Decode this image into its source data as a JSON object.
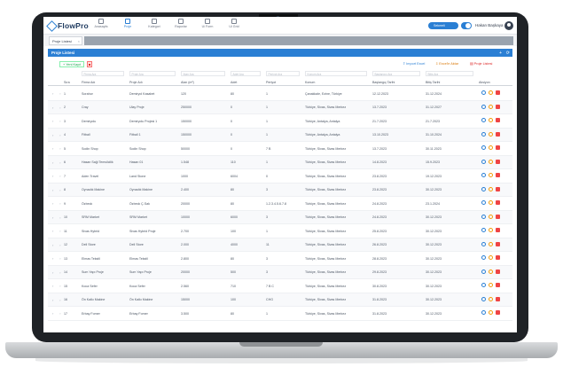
{
  "app": {
    "logo": "FlowPro"
  },
  "nav": [
    {
      "label": "Anasayfa",
      "active": false
    },
    {
      "label": "Proje",
      "active": true
    },
    {
      "label": "Kategori",
      "active": false
    },
    {
      "label": "Raporlar",
      "active": false
    },
    {
      "label": "Ui Form",
      "active": false
    },
    {
      "label": "Ui Grid",
      "active": false
    }
  ],
  "header": {
    "toggle_label": "Sekmeli",
    "user_name": "Hakan Başkaya"
  },
  "tabs": [
    {
      "label": "Proje Listesi"
    }
  ],
  "panel": {
    "title": "Proje Listesi"
  },
  "toolbar": {
    "add_label": "Yeni Kayıt",
    "import_label": "Import Excel",
    "export_label": "Excel'e Aktar",
    "list_label": "Proje Listesi"
  },
  "filters": [
    "Firma Ara",
    "Proje Ara",
    "Alan Ara",
    "Adet Ara",
    "Periyot Ara",
    "Konum Ara",
    "Başlangıç Ara",
    "Bitiş Ara"
  ],
  "table": {
    "columns": [
      "Sıra",
      "Firma Adı",
      "Proje Adı",
      "Alan (m²)",
      "Adet",
      "Periyot",
      "Konum",
      "Başlangıç Tarihi",
      "Bitiş Tarihi",
      "Aksiyon"
    ],
    "rows": [
      [
        "1",
        "Sorahor",
        "Demiryol Kasabet",
        "120",
        "80",
        "1",
        "Çanakkale, Ezine, Türkiye",
        "12.12.2023",
        "31.12.2024"
      ],
      [
        "2",
        "Cray",
        "Ulay Proje",
        "250000",
        "0",
        "1",
        "Türkiye, Sivas, Sivas Merkez",
        "13.7.2023",
        "31.12.2027"
      ],
      [
        "3",
        "Demiryolu",
        "Demiryolu Projesi 1",
        "150000",
        "0",
        "1",
        "Türkiye, Antalya, Antalya",
        "21.7.2023",
        "21.7.2023"
      ],
      [
        "4",
        "Fitball",
        "Fitball 1",
        "150000",
        "0",
        "1",
        "Türkiye, Antalya, Antalya",
        "13.10.2023",
        "31.10.2024"
      ],
      [
        "5",
        "Sodin Shop",
        "Sodin Shop",
        "50000",
        "0",
        "7 B",
        "Türkiye, Sivas, Sivas Merkez",
        "13.7.2023",
        "30.11.2023"
      ],
      [
        "6",
        "Hasan Saği Temsilcilik",
        "Hasan 01",
        "1.548",
        "110",
        "1",
        "Türkiye, Sivas, Sivas Merkez",
        "14.8.2023",
        "15.9.2023"
      ],
      [
        "7",
        "Aden Travel",
        "Land Stone",
        "1000",
        "6004",
        "0",
        "Türkiye, Sivas, Sivas Merkez",
        "23.8.2023",
        "19.12.2023"
      ],
      [
        "8",
        "Oynadık Makine",
        "Oynadık Makine",
        "2.400",
        "80",
        "3",
        "Türkiye, Sivas, Sivas Merkez",
        "23.8.2023",
        "30.12.2023"
      ],
      [
        "9",
        "Özbeck",
        "Özbeck Ç.Sak",
        "20000",
        "80",
        "1.2.3.4.5.6.7.8",
        "Türkiye, Sivas, Sivas Merkez",
        "24.8.2023",
        "23.1.2024"
      ],
      [
        "10",
        "SRM Market",
        "SRM Market",
        "10000",
        "6000",
        "3",
        "Türkiye, Sivas, Sivas Merkez",
        "24.8.2023",
        "30.12.2023"
      ],
      [
        "11",
        "Sivas Hybrid",
        "Sivas Hybrid Proje",
        "2.700",
        "100",
        "1",
        "Türkiye, Sivas, Sivas Merkez",
        "25.8.2023",
        "30.12.2023"
      ],
      [
        "12",
        "Dell Store",
        "Dell Store",
        "2.000",
        "4000",
        "11",
        "Türkiye, Sivas, Sivas Merkez",
        "26.8.2023",
        "30.12.2023"
      ],
      [
        "13",
        "Elmas Tekstil",
        "Elmas Tekstil",
        "2.800",
        "80",
        "3",
        "Türkiye, Sivas, Sivas Merkez",
        "28.8.2023",
        "30.12.2023"
      ],
      [
        "14",
        "Sum Yapı Proje",
        "Sum Yapı Proje",
        "20000",
        "500",
        "3",
        "Türkiye, Sivas, Sivas Merkez",
        "29.8.2023",
        "30.12.2023"
      ],
      [
        "15",
        "Koca Sefer",
        "Koca Sefer",
        "2.560",
        "710",
        "7 B C",
        "Türkiye, Sivas, Sivas Merkez",
        "30.8.2023",
        "30.12.2023"
      ],
      [
        "16",
        "Ön Kalkı Makine",
        "Ön Kalkı Makine",
        "15000",
        "100",
        "CHG",
        "Türkiye, Sivas, Sivas Merkez",
        "31.8.2023",
        "30.12.2023"
      ],
      [
        "17",
        "Erbay Fomer",
        "Erbay Fomer",
        "3.500",
        "80",
        "1",
        "Türkiye, Sivas, Sivas Merkez",
        "31.8.2023",
        "30.12.2023"
      ]
    ]
  }
}
